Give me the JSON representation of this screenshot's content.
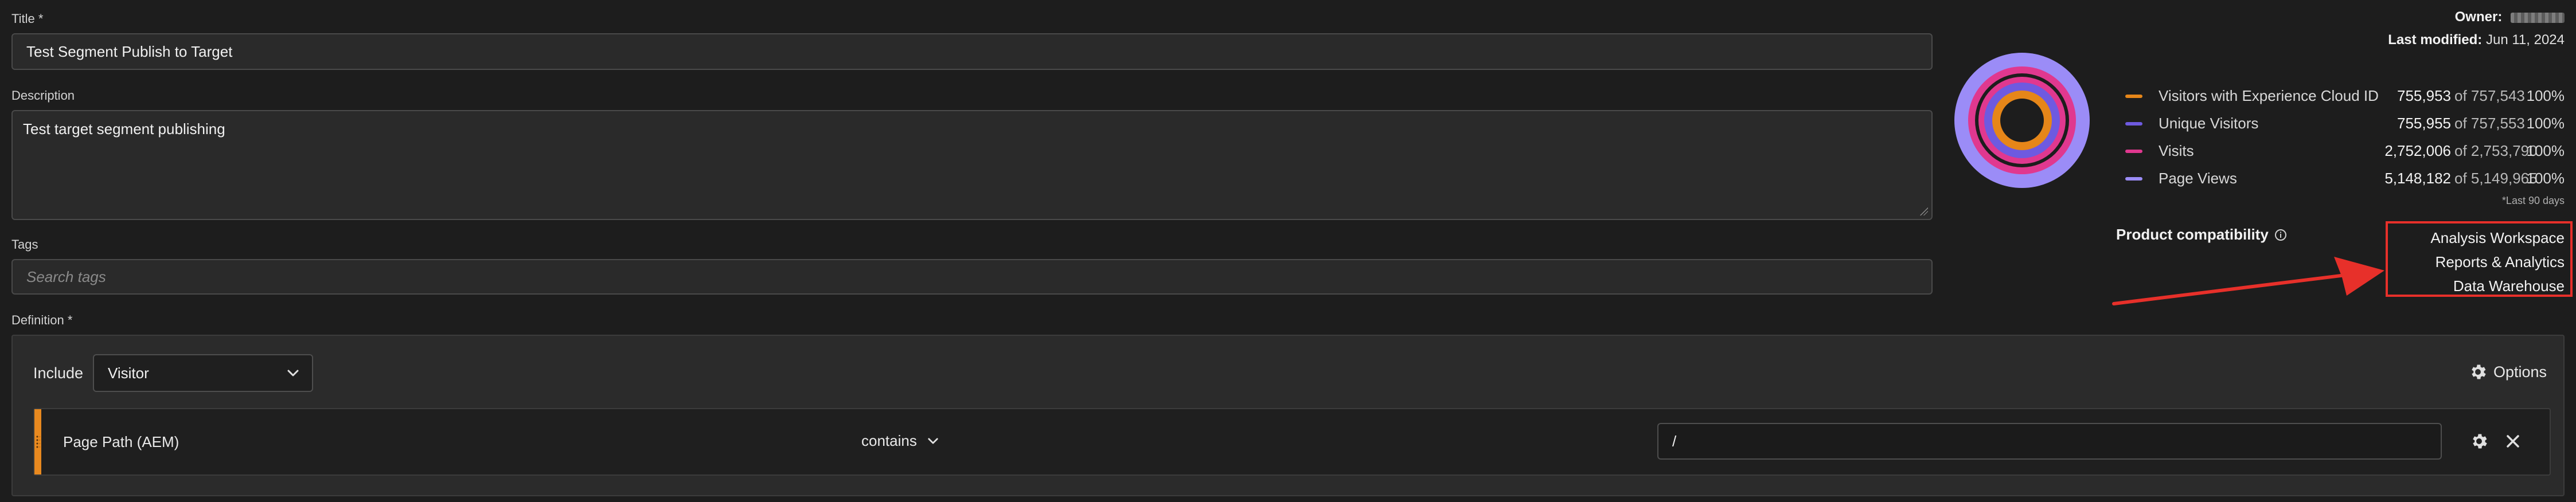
{
  "title_field": {
    "label": "Title",
    "required_mark": "*",
    "value": "Test Segment Publish to Target"
  },
  "description_field": {
    "label": "Description",
    "value": "Test target segment publishing"
  },
  "tags_field": {
    "label": "Tags",
    "placeholder": "Search tags"
  },
  "definition": {
    "label": "Definition",
    "required_mark": "*",
    "include_label": "Include",
    "container_select": "Visitor",
    "options_label": "Options",
    "rule": {
      "dimension": "Page Path (AEM)",
      "operator": "contains",
      "value": "/"
    }
  },
  "summary": {
    "owner_label": "Owner:",
    "last_modified_label": "Last modified:",
    "last_modified_value": "Jun 11, 2024",
    "metrics": [
      {
        "name": "Visitors with Experience Cloud ID",
        "value": "755,953",
        "of": "of 757,543",
        "percent": "100%",
        "color": "#e68619"
      },
      {
        "name": "Unique Visitors",
        "value": "755,955",
        "of": "of 757,553",
        "percent": "100%",
        "color": "#6e5ae0"
      },
      {
        "name": "Visits",
        "value": "2,752,006",
        "of": "of 2,753,790",
        "percent": "100%",
        "color": "#e0388f"
      },
      {
        "name": "Page Views",
        "value": "5,148,182",
        "of": "of 5,149,965",
        "percent": "100%",
        "color": "#9b8cf7"
      }
    ],
    "footnote": "*Last 90 days",
    "product_compat_label": "Product compatibility",
    "products": [
      "Analysis Workspace",
      "Reports & Analytics",
      "Data Warehouse"
    ]
  },
  "icons": [
    "info-icon",
    "gear-icon",
    "chevron-down-icon",
    "close-icon",
    "drag-handle-icon"
  ],
  "colors": {
    "annotation_red": "#e7302a",
    "drag_handle": "#e8891f"
  }
}
